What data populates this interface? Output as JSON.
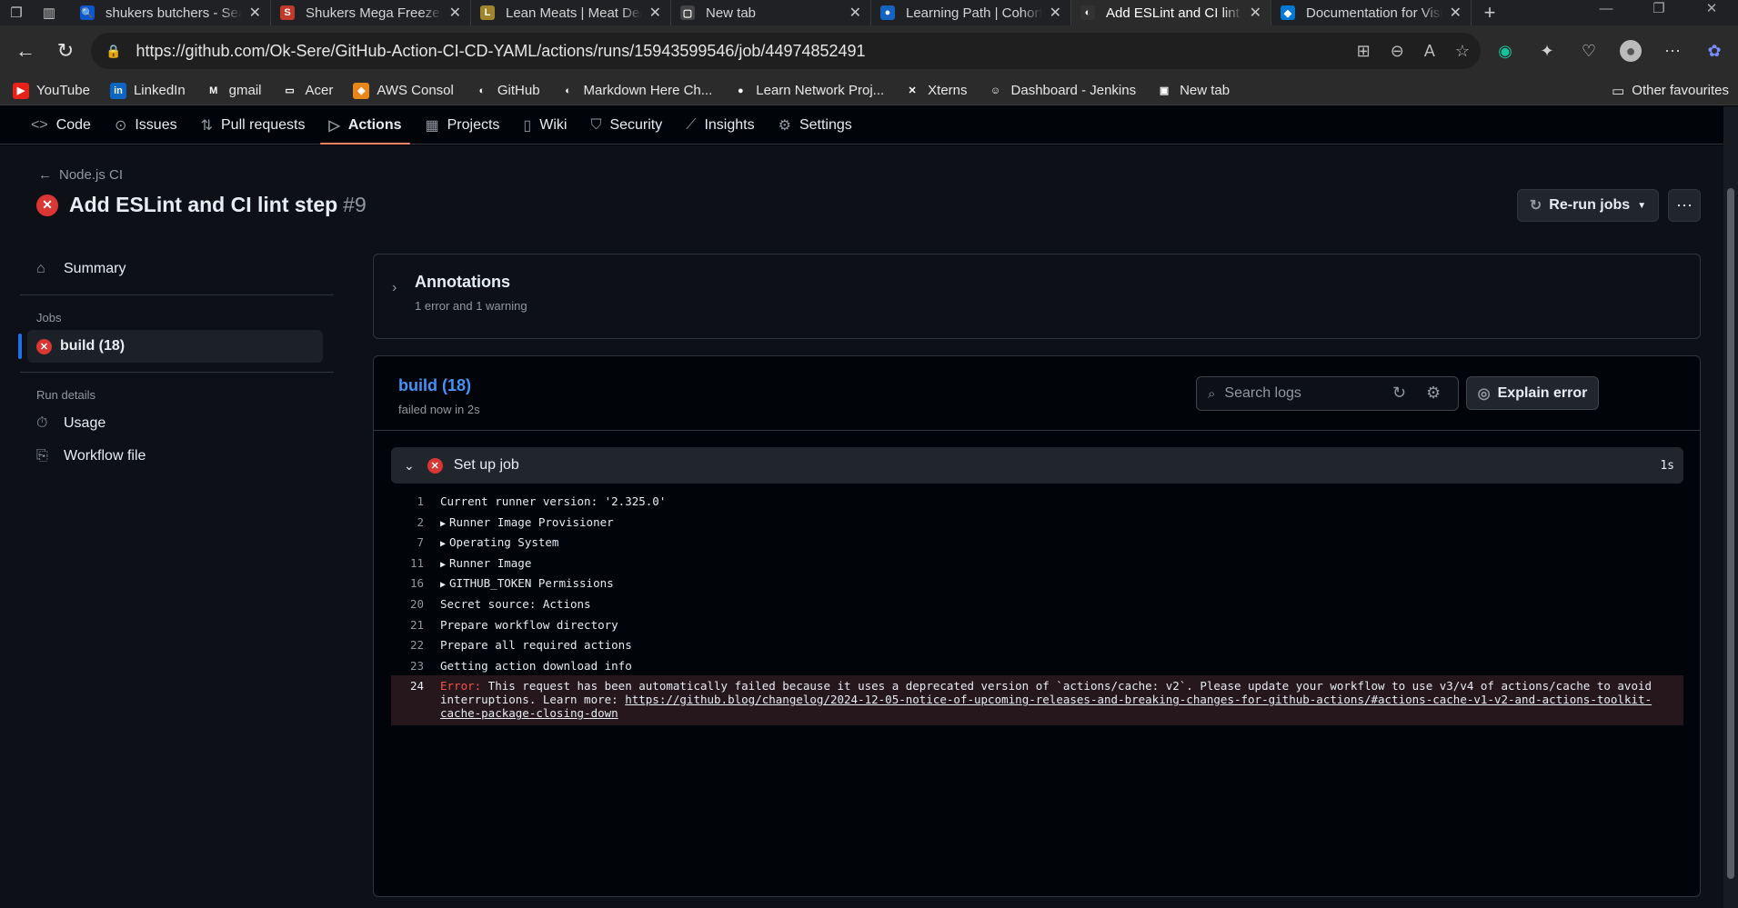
{
  "browser": {
    "tabs": [
      {
        "title": "shukers butchers - Search",
        "fav_color": "#0b57d0",
        "fav_glyph": "🔍"
      },
      {
        "title": "Shukers Mega Freezer",
        "fav_color": "#c0392b",
        "fav_glyph": "S"
      },
      {
        "title": "Lean Meats | Meat Deals",
        "fav_color": "#a0842b",
        "fav_glyph": "L"
      },
      {
        "title": "New tab",
        "fav_color": "#444",
        "fav_glyph": "▢"
      },
      {
        "title": "Learning Path | Cohort",
        "fav_color": "#1565c0",
        "fav_glyph": "●"
      },
      {
        "title": "Add ESLint and CI lint step",
        "fav_color": "#333",
        "fav_glyph": "◐"
      },
      {
        "title": "Documentation for Visual Studio Code",
        "fav_color": "#0078d4",
        "fav_glyph": "◆"
      }
    ],
    "active_tab_index": 5,
    "url": "https://github.com/Ok-Sere/GitHub-Action-CI-CD-YAML/actions/runs/15943599546/job/44974852491",
    "favourites": [
      {
        "label": "YouTube",
        "color": "#e62117",
        "glyph": "▶"
      },
      {
        "label": "LinkedIn",
        "color": "#0a66c2",
        "glyph": "in"
      },
      {
        "label": "gmail",
        "color": "#2b2b2b",
        "glyph": "M"
      },
      {
        "label": "Acer",
        "color": "#2b2b2b",
        "glyph": "▭"
      },
      {
        "label": "AWS Consol",
        "color": "#e8851b",
        "glyph": "◈"
      },
      {
        "label": "GitHub",
        "color": "#2b2b2b",
        "glyph": "◐"
      },
      {
        "label": "Markdown Here Ch...",
        "color": "#2b2b2b",
        "glyph": "◐"
      },
      {
        "label": "Learn Network Proj...",
        "color": "#2b2b2b",
        "glyph": "●"
      },
      {
        "label": "Xterns",
        "color": "#2b2b2b",
        "glyph": "✕"
      },
      {
        "label": "Dashboard - Jenkins",
        "color": "#2b2b2b",
        "glyph": "☺"
      },
      {
        "label": "New tab",
        "color": "#2b2b2b",
        "glyph": "▣"
      }
    ],
    "other_favourites": "Other favourites"
  },
  "repo_nav": [
    {
      "label": "Code",
      "icon": "code-icon",
      "glyph": "<>"
    },
    {
      "label": "Issues",
      "icon": "issue-icon",
      "glyph": "⊙"
    },
    {
      "label": "Pull requests",
      "icon": "pull-request-icon",
      "glyph": "⇅"
    },
    {
      "label": "Actions",
      "icon": "play-icon",
      "glyph": "▷",
      "active": true
    },
    {
      "label": "Projects",
      "icon": "table-icon",
      "glyph": "▦"
    },
    {
      "label": "Wiki",
      "icon": "book-icon",
      "glyph": "▯"
    },
    {
      "label": "Security",
      "icon": "shield-icon",
      "glyph": "⛉"
    },
    {
      "label": "Insights",
      "icon": "graph-icon",
      "glyph": "⟋"
    },
    {
      "label": "Settings",
      "icon": "gear-icon",
      "glyph": "⚙"
    }
  ],
  "run": {
    "back_label": "Node.js CI",
    "title": "Add ESLint and CI lint step",
    "number": "#9",
    "rerun_label": "Re-run jobs"
  },
  "sidebar": {
    "summary": "Summary",
    "jobs_heading": "Jobs",
    "job": "build (18)",
    "run_details_heading": "Run details",
    "usage": "Usage",
    "workflow_file": "Workflow file"
  },
  "annotations": {
    "title": "Annotations",
    "subtitle": "1 error and 1 warning"
  },
  "job_panel": {
    "name": "build (18)",
    "status": "failed now in 2s",
    "search_placeholder": "Search logs",
    "explain_label": "Explain error"
  },
  "step": {
    "name": "Set up job",
    "duration": "1s"
  },
  "log_lines": [
    {
      "num": "1",
      "text": "Current runner version: '2.325.0'"
    },
    {
      "num": "2",
      "text": "Runner Image Provisioner",
      "collapsible": true
    },
    {
      "num": "7",
      "text": "Operating System",
      "collapsible": true
    },
    {
      "num": "11",
      "text": "Runner Image",
      "collapsible": true
    },
    {
      "num": "16",
      "text": "GITHUB_TOKEN Permissions",
      "collapsible": true
    },
    {
      "num": "20",
      "text": "Secret source: Actions"
    },
    {
      "num": "21",
      "text": "Prepare workflow directory"
    },
    {
      "num": "22",
      "text": "Prepare all required actions"
    },
    {
      "num": "23",
      "text": "Getting action download info"
    }
  ],
  "error_line": {
    "num": "24",
    "label": "Error:",
    "text": " This request has been automatically failed because it uses a deprecated version of `actions/cache: v2`. Please update your workflow to use v3/v4 of actions/cache to avoid interruptions. Learn more: ",
    "link": "https://github.blog/changelog/2024-12-05-notice-of-upcoming-releases-and-breaking-changes-for-github-actions/#actions-cache-v1-v2-and-actions-toolkit-cache-package-closing-down"
  }
}
